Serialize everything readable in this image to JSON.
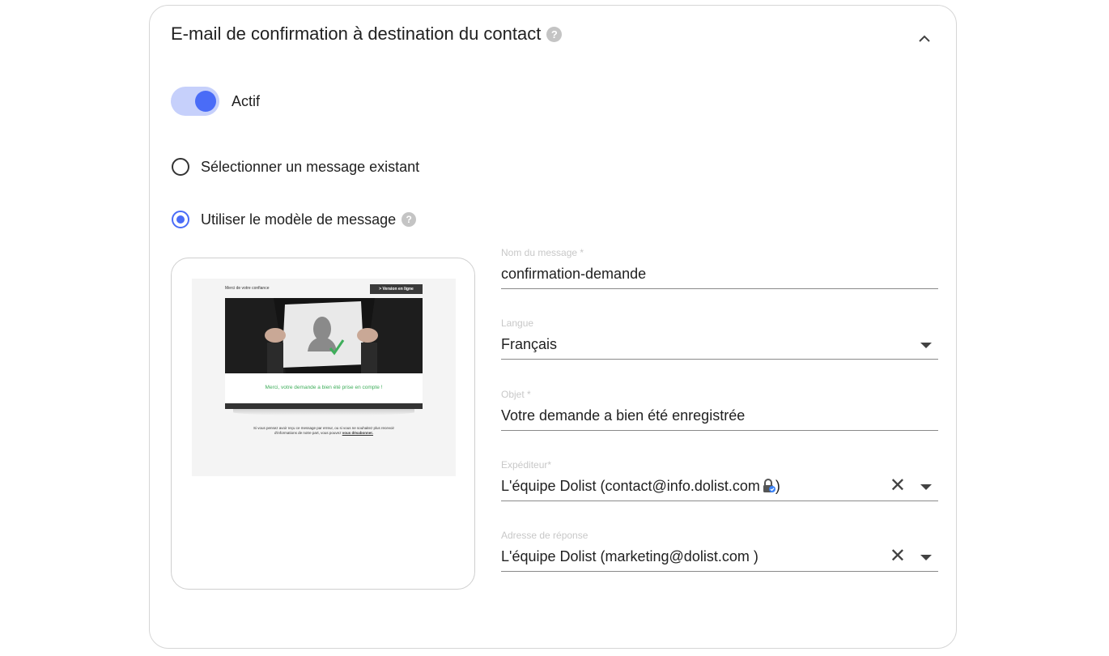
{
  "card": {
    "title": "E-mail de confirmation à destination du contact",
    "help_icon": "question-circle-icon",
    "collapse_icon": "chevron-up-icon"
  },
  "toggle": {
    "label": "Actif",
    "state": "on"
  },
  "options": {
    "existing_label": "Sélectionner un message existant",
    "template_label": "Utiliser le modèle de message",
    "selected": "template"
  },
  "preview": {
    "header_text": "Merci de votre confiance",
    "online_button": "> Version en ligne",
    "thanks_text": "Merci, votre demande a bien été prise en compte !",
    "footer_text_1": "Si vous pensez avoir reçu ce message par erreur, ou si vous ne souhaitez plus recevoir",
    "footer_text_2": "d'informations de notre part, vous pouvez",
    "footer_link": "vous désabonner."
  },
  "form": {
    "message_name": {
      "label": "Nom du message *",
      "value": "confirmation-demande"
    },
    "language": {
      "label": "Langue",
      "value": "Français"
    },
    "subject": {
      "label": "Objet *",
      "value": "Votre demande a bien été enregistrée"
    },
    "sender": {
      "label": "Expéditeur*",
      "value_prefix": "L'équipe Dolist (contact@info.dolist.com",
      "value_suffix": ")"
    },
    "reply_to": {
      "label": "Adresse de réponse",
      "value": "L'équipe Dolist (marketing@dolist.com )"
    }
  },
  "colors": {
    "accent": "#4a6cf7",
    "toggle_track": "#c6d0fb",
    "label_muted": "#c8c8c8"
  }
}
